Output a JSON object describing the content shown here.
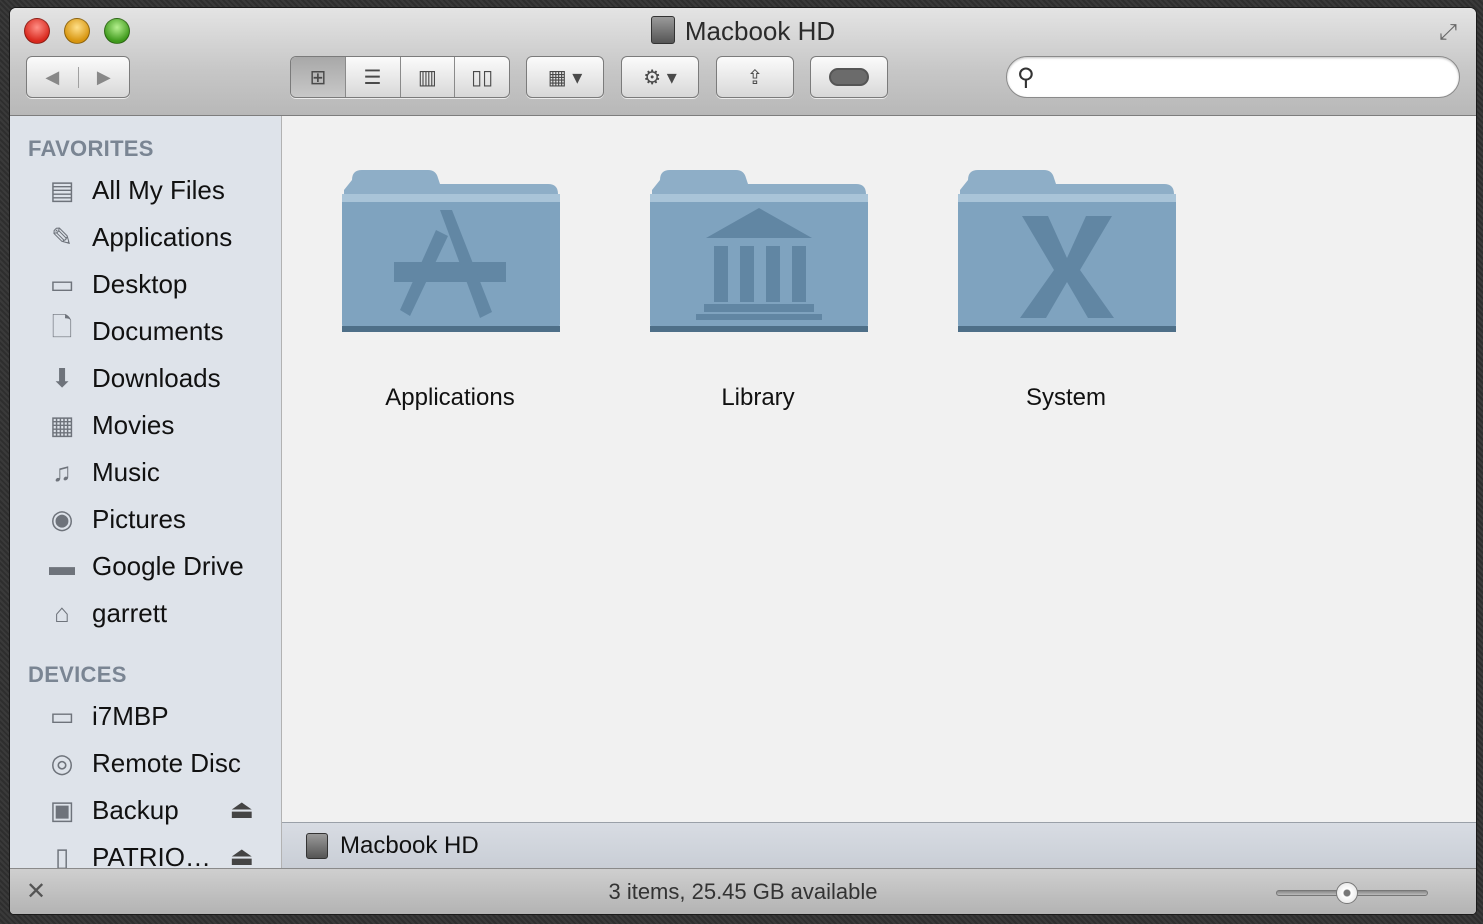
{
  "window": {
    "title": "Macbook HD",
    "icons": {
      "drive": "hard-drive-icon",
      "fullscreen": "fullscreen-icon"
    }
  },
  "toolbar": {
    "back": "◀",
    "forward": "▶",
    "view_icon": "⊞",
    "view_list": "☰",
    "view_columns": "▥",
    "view_coverflow": "▯▯",
    "arrange": "▦ ▾",
    "action": "⚙ ▾",
    "share": "⇪",
    "search_placeholder": ""
  },
  "sidebar": {
    "favorites_heading": "FAVORITES",
    "devices_heading": "DEVICES",
    "favorites": [
      {
        "label": "All My Files",
        "icon": "all-files-icon"
      },
      {
        "label": "Applications",
        "icon": "applications-icon"
      },
      {
        "label": "Desktop",
        "icon": "desktop-icon"
      },
      {
        "label": "Documents",
        "icon": "documents-icon"
      },
      {
        "label": "Downloads",
        "icon": "downloads-icon"
      },
      {
        "label": "Movies",
        "icon": "movies-icon"
      },
      {
        "label": "Music",
        "icon": "music-icon"
      },
      {
        "label": "Pictures",
        "icon": "pictures-icon"
      },
      {
        "label": "Google Drive",
        "icon": "folder-icon"
      },
      {
        "label": "garrett",
        "icon": "home-icon"
      }
    ],
    "devices": [
      {
        "label": "i7MBP",
        "icon": "laptop-icon"
      },
      {
        "label": "Remote Disc",
        "icon": "disc-icon"
      },
      {
        "label": "Backup",
        "icon": "backup-drive-icon"
      },
      {
        "label": "PATRIO…",
        "icon": "external-drive-icon"
      }
    ]
  },
  "content": {
    "items": [
      {
        "label": "Applications",
        "icon": "applications-folder-icon"
      },
      {
        "label": "Library",
        "icon": "library-folder-icon"
      },
      {
        "label": "System",
        "icon": "system-folder-icon"
      }
    ]
  },
  "pathbar": {
    "label": "Macbook HD"
  },
  "status": {
    "text": "3 items, 25.45 GB available",
    "icon_size_fraction": 0.45
  }
}
